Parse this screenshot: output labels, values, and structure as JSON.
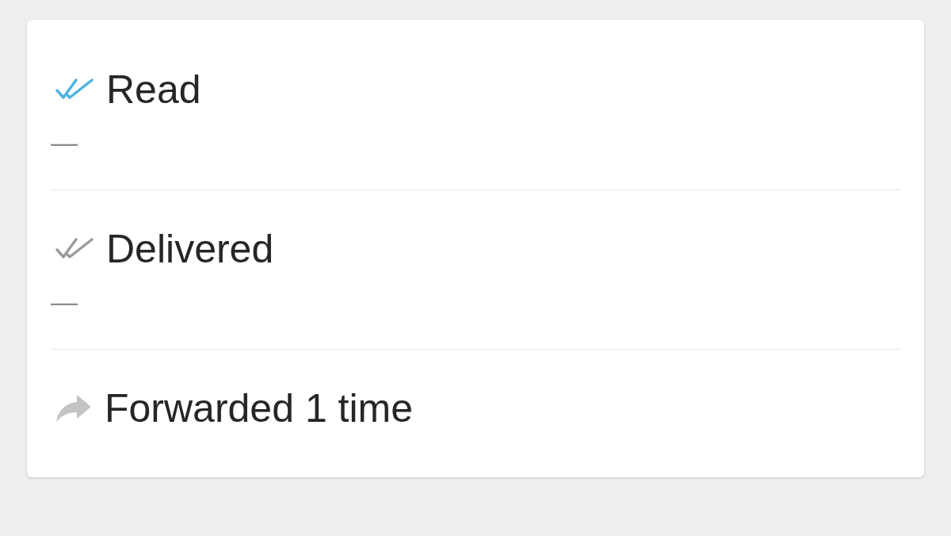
{
  "message_info": {
    "rows": [
      {
        "kind": "read",
        "label": "Read",
        "time": "—"
      },
      {
        "kind": "delivered",
        "label": "Delivered",
        "time": "—"
      },
      {
        "kind": "forwarded",
        "label": "Forwarded 1 time"
      }
    ]
  }
}
